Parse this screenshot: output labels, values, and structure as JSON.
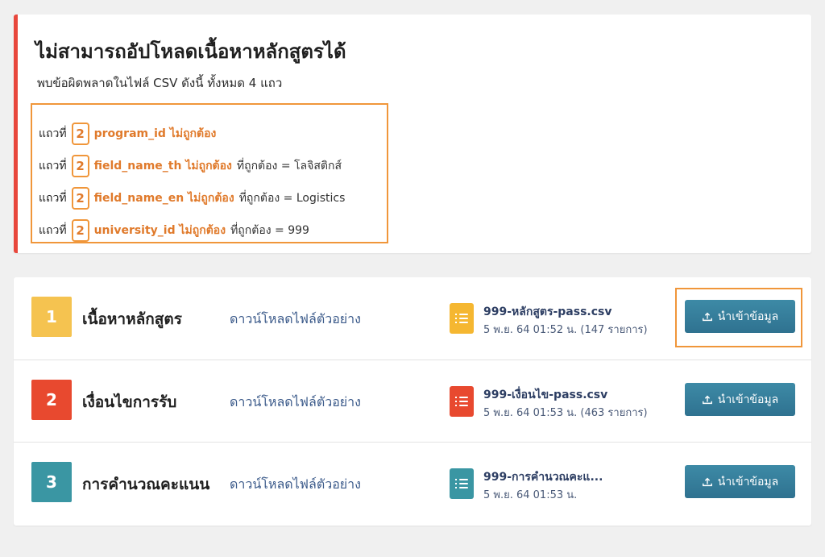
{
  "error": {
    "title": "ไม่สามารถอัปโหลดเนื้อหาหลักสูตรได้",
    "subtitle": "พบข้อผิดพลาดในไฟล์ CSV ดังนี้ ทั้งหมด 4 แถว",
    "accent_color": "#e8473c",
    "highlight_color": "#f0963a",
    "rows": [
      {
        "prefix": "แถวที่",
        "row": "2",
        "field": "program_id ไม่ถูกต้อง",
        "expected": ""
      },
      {
        "prefix": "แถวที่",
        "row": "2",
        "field": "field_name_th ไม่ถูกต้อง",
        "expected": "ที่ถูกต้อง = โลจิสติกส์"
      },
      {
        "prefix": "แถวที่",
        "row": "2",
        "field": "field_name_en ไม่ถูกต้อง",
        "expected": "ที่ถูกต้อง = Logistics"
      },
      {
        "prefix": "แถวที่",
        "row": "2",
        "field": "university_id ไม่ถูกต้อง",
        "expected": "ที่ถูกต้อง = 999"
      }
    ]
  },
  "uploads": [
    {
      "step": "1",
      "name": "เนื้อหาหลักสูตร",
      "step_color": "#f5c350",
      "sample_link": "ดาวน์โหลดไฟล์ตัวอย่าง",
      "file_icon": "file-list-icon",
      "file_color": "#f5b731",
      "file_name": "999-หลักสูตร-pass.csv",
      "file_meta": "5 พ.ย. 64 01:52 น. (147 รายการ)",
      "button": "นำเข้าข้อมูล"
    },
    {
      "step": "2",
      "name": "เงื่อนไขการรับ",
      "step_color": "#e8492f",
      "sample_link": "ดาวน์โหลดไฟล์ตัวอย่าง",
      "file_icon": "file-list-icon",
      "file_color": "#e8492f",
      "file_name": "999-เงื่อนไข-pass.csv",
      "file_meta": "5 พ.ย. 64 01:53 น. (463 รายการ)",
      "button": "นำเข้าข้อมูล"
    },
    {
      "step": "3",
      "name": "การคำนวณคะแนน",
      "step_color": "#3a96a3",
      "sample_link": "ดาวน์โหลดไฟล์ตัวอย่าง",
      "file_icon": "file-list-icon",
      "file_color": "#3a96a3",
      "file_name": "999-การคำนวณคะแ...",
      "file_meta": "5 พ.ย. 64 01:53 น.",
      "button": "นำเข้าข้อมูล"
    }
  ]
}
